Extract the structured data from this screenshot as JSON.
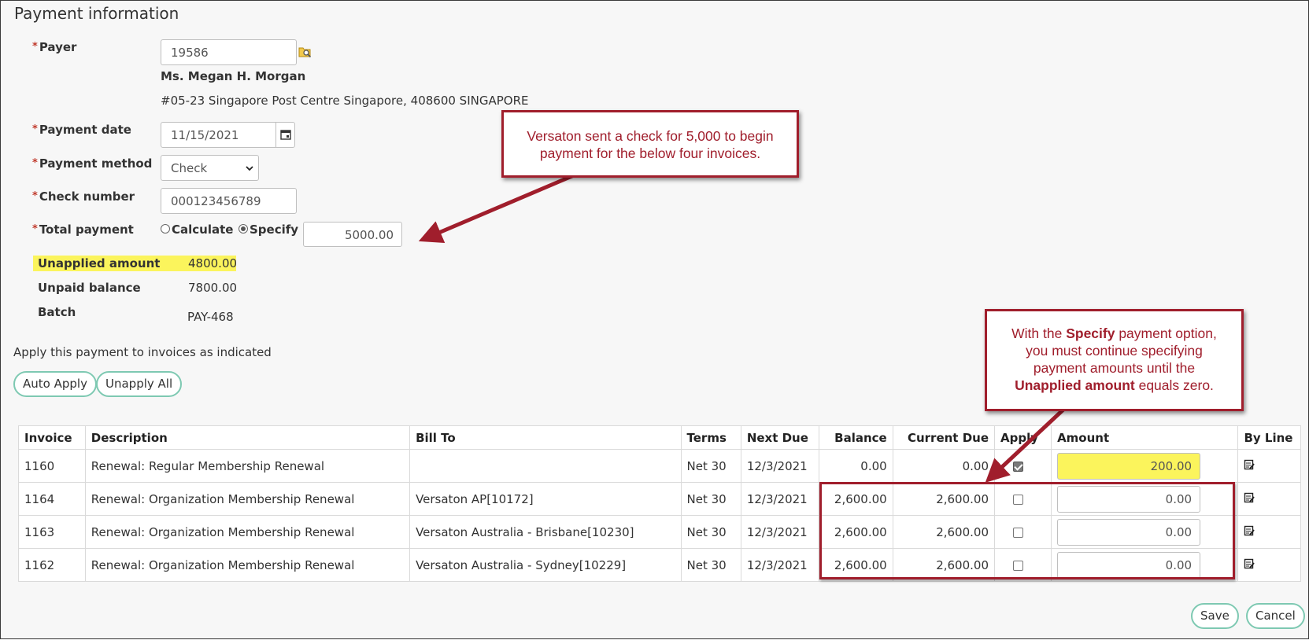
{
  "section_title": "Payment information",
  "payer": {
    "label": "Payer",
    "value": "19586",
    "name": "Ms. Megan H. Morgan",
    "address": "#05-23 Singapore Post Centre Singapore, 408600 SINGAPORE"
  },
  "payment_date": {
    "label": "Payment date",
    "value": "11/15/2021"
  },
  "payment_method": {
    "label": "Payment method",
    "value": "Check"
  },
  "check_number": {
    "label": "Check number",
    "value": "000123456789"
  },
  "total_payment": {
    "label": "Total payment",
    "option_calculate": "Calculate",
    "option_specify": "Specify",
    "selected": "Specify",
    "value": "5000.00"
  },
  "summary": {
    "unapplied_label": "Unapplied amount",
    "unapplied_value": "4800.00",
    "unpaid_label": "Unpaid balance",
    "unpaid_value": "7800.00",
    "batch_label": "Batch",
    "batch_value": "PAY-468"
  },
  "apply_text": "Apply this payment to invoices as indicated",
  "buttons": {
    "auto_apply": "Auto Apply",
    "unapply_all": "Unapply All",
    "save": "Save",
    "cancel": "Cancel"
  },
  "table": {
    "headers": [
      "Invoice",
      "Description",
      "Bill To",
      "Terms",
      "Next Due",
      "Balance",
      "Current Due",
      "Apply",
      "Amount",
      "By Line"
    ],
    "rows": [
      {
        "invoice": "1160",
        "description": "Renewal: Regular Membership Renewal",
        "bill_to": "",
        "terms": "Net 30",
        "next_due": "12/3/2021",
        "balance": "0.00",
        "current_due": "0.00",
        "applied": true,
        "amount": "200.00"
      },
      {
        "invoice": "1164",
        "description": "Renewal: Organization Membership Renewal",
        "bill_to": "Versaton AP[10172]",
        "terms": "Net 30",
        "next_due": "12/3/2021",
        "balance": "2,600.00",
        "current_due": "2,600.00",
        "applied": false,
        "amount": "0.00"
      },
      {
        "invoice": "1163",
        "description": "Renewal: Organization Membership Renewal",
        "bill_to": "Versaton Australia - Brisbane[10230]",
        "terms": "Net 30",
        "next_due": "12/3/2021",
        "balance": "2,600.00",
        "current_due": "2,600.00",
        "applied": false,
        "amount": "0.00"
      },
      {
        "invoice": "1162",
        "description": "Renewal: Organization Membership Renewal",
        "bill_to": "Versaton Australia - Sydney[10229]",
        "terms": "Net 30",
        "next_due": "12/3/2021",
        "balance": "2,600.00",
        "current_due": "2,600.00",
        "applied": false,
        "amount": "0.00"
      }
    ]
  },
  "callouts": {
    "check": {
      "line1": "Versaton sent a check for 5,000 to begin",
      "line2": "payment for the below four invoices."
    },
    "specify": {
      "p1": "With the ",
      "b1": "Specify",
      "p2": " payment option,",
      "line2": "you must continue specifying",
      "line3": "payment amounts until the",
      "b2": "Unapplied amount",
      "p3": " equals zero."
    }
  },
  "colors": {
    "accent_teal": "#7ec9b2",
    "highlight_yellow": "#fbf45c",
    "callout_red": "#a01e2c",
    "link_blue": "#1f6f9e"
  }
}
